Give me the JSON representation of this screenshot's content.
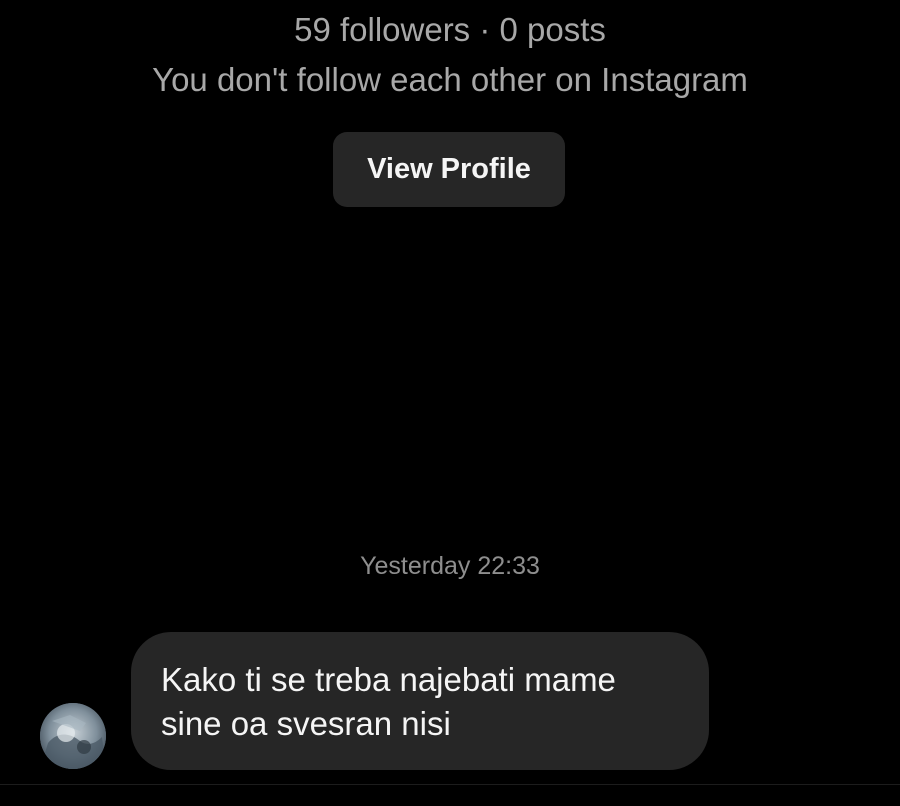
{
  "profile": {
    "stats": "59 followers · 0 posts",
    "follow_status": "You don't follow each other on Instagram",
    "view_profile_label": "View Profile"
  },
  "conversation": {
    "timestamp": "Yesterday 22:33",
    "messages": [
      {
        "sender": "other",
        "text": "Kako ti se treba najebati mame\nsine oa svesran nisi",
        "avatar_icon": "profile-photo-icon"
      }
    ]
  },
  "colors": {
    "background": "#000000",
    "bubble": "#262626",
    "button": "#262626",
    "secondary_text": "#a8a8a8",
    "primary_text": "#f5f5f5"
  }
}
